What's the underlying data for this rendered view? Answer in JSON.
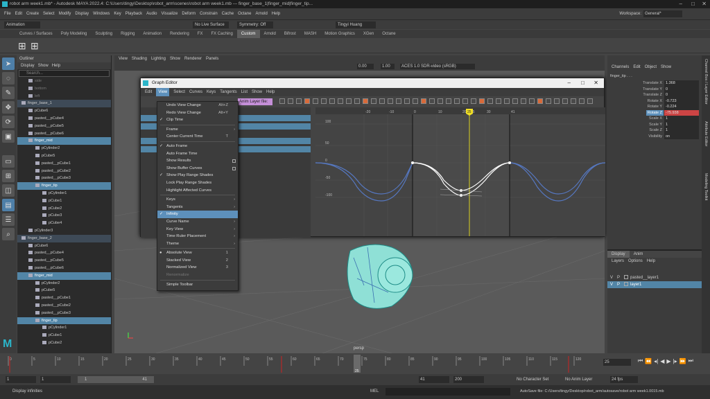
{
  "window_title": "robot arm week1.mb* - Autodesk MAYA 2022.4: C:\\Users\\tingy\\Desktop\\robot_arm\\scenes\\robot arm week1.mb  ---  finger_base_1|finger_mid|finger_tip...",
  "menubar": [
    "File",
    "Edit",
    "Create",
    "Select",
    "Modify",
    "Display",
    "Windows",
    "Key",
    "Playback",
    "Audio",
    "Visualize",
    "Deform",
    "Constrain",
    "Cache",
    "Octane",
    "Arnold",
    "Help"
  ],
  "workspace": {
    "label": "Workspace:",
    "value": "General*"
  },
  "status": {
    "mode": "Animation",
    "live": "No Live Surface",
    "symmetry": "Symmetry: Off",
    "user": "Tingyi Huang"
  },
  "shelf_tabs": [
    "Curves / Surfaces",
    "Poly Modeling",
    "Sculpting",
    "Rigging",
    "Animation",
    "Rendering",
    "FX",
    "FX Caching",
    "Custom",
    "Arnold",
    "Bifrost",
    "MASH",
    "Motion Graphics",
    "XGen",
    "Octane"
  ],
  "shelf_active": "Custom",
  "outliner": {
    "title": "Outliner",
    "menu": [
      "Display",
      "Show",
      "Help"
    ],
    "search_placeholder": "Search...",
    "rows": [
      {
        "t": "side",
        "d": 1,
        "s": "dim"
      },
      {
        "t": "bottom",
        "d": 1,
        "s": "dim"
      },
      {
        "t": "left",
        "d": 1,
        "s": "dim"
      },
      {
        "t": "finger_base_1",
        "d": 0,
        "s": "sel"
      },
      {
        "t": "pCube6",
        "d": 1
      },
      {
        "t": "pasted__pCube4",
        "d": 1
      },
      {
        "t": "pasted__pCube5",
        "d": 1
      },
      {
        "t": "pasted__pCube6",
        "d": 1
      },
      {
        "t": "finger_mid",
        "d": 1,
        "s": "hl"
      },
      {
        "t": "pCylinder2",
        "d": 2
      },
      {
        "t": "pCube5",
        "d": 2
      },
      {
        "t": "pasted__pCube1",
        "d": 2
      },
      {
        "t": "pasted__pCube2",
        "d": 2
      },
      {
        "t": "pasted__pCube3",
        "d": 2
      },
      {
        "t": "finger_tip",
        "d": 2,
        "s": "hl"
      },
      {
        "t": "pCylinder1",
        "d": 3
      },
      {
        "t": "pCube1",
        "d": 3
      },
      {
        "t": "pCube2",
        "d": 3
      },
      {
        "t": "pCube3",
        "d": 3
      },
      {
        "t": "pCube4",
        "d": 3
      },
      {
        "t": "pCylinder3",
        "d": 1
      },
      {
        "t": "finger_base_2",
        "d": 0,
        "s": "sel"
      },
      {
        "t": "pCube6",
        "d": 1
      },
      {
        "t": "pasted__pCube4",
        "d": 1
      },
      {
        "t": "pasted__pCube5",
        "d": 1
      },
      {
        "t": "pasted__pCube6",
        "d": 1
      },
      {
        "t": "finger_mid",
        "d": 1,
        "s": "hl"
      },
      {
        "t": "pCylinder2",
        "d": 2
      },
      {
        "t": "pCube5",
        "d": 2
      },
      {
        "t": "pasted__pCube1",
        "d": 2
      },
      {
        "t": "pasted__pCube2",
        "d": 2
      },
      {
        "t": "pasted__pCube3",
        "d": 2
      },
      {
        "t": "finger_tip",
        "d": 2,
        "s": "hl"
      },
      {
        "t": "pCylinder1",
        "d": 3
      },
      {
        "t": "pCube1",
        "d": 3
      },
      {
        "t": "pCube2",
        "d": 3
      }
    ]
  },
  "viewport": {
    "menu": [
      "View",
      "Shading",
      "Lighting",
      "Show",
      "Renderer",
      "Panels"
    ],
    "exposure": "0.00",
    "gamma": "1.00",
    "colorspace": "ACES 1.0 SDR-video (sRGB)",
    "camera": "persp"
  },
  "graph_editor": {
    "title": "Graph Editor",
    "menu": [
      "Edit",
      "View",
      "Select",
      "Curves",
      "Keys",
      "Tangents",
      "List",
      "Show",
      "Help"
    ],
    "active_menu": "View",
    "anim_layer_label": "Anim Layer file: C:/..",
    "frame_ticks": [
      "-20",
      "-10",
      "0",
      "10",
      "20",
      "25",
      "30",
      "41"
    ],
    "current_frame": "25",
    "value_ticks": [
      "100",
      "50",
      "0",
      "-50",
      "-100"
    ]
  },
  "view_menu": [
    {
      "label": "Undo View Change",
      "sc": "Alt+Z"
    },
    {
      "label": "Redo View Change",
      "sc": "Alt+Y"
    },
    {
      "label": "Clip Time",
      "ck": "✓"
    },
    {
      "sep": true
    },
    {
      "label": "Frame",
      "ar": "›"
    },
    {
      "label": "Center Current Time",
      "sc": "T"
    },
    {
      "sep": true
    },
    {
      "label": "Auto Frame",
      "ck": "✓"
    },
    {
      "label": "Auto Frame Time"
    },
    {
      "label": "Show Results",
      "bx": true
    },
    {
      "label": "Show Buffer Curves",
      "bx": true
    },
    {
      "label": "Show Play Range Shades",
      "ck": "✓"
    },
    {
      "label": "Lock Play Range Shades"
    },
    {
      "label": "Highlight Affected Curves"
    },
    {
      "sep": true
    },
    {
      "label": "Keys",
      "ar": "›"
    },
    {
      "label": "Tangents",
      "ar": "›"
    },
    {
      "label": "Infinity",
      "ck": "✓",
      "hl": true
    },
    {
      "label": "Curve Name",
      "ar": "›"
    },
    {
      "label": "Key View",
      "ar": "›"
    },
    {
      "label": "Time Ruler Placement",
      "ar": "›"
    },
    {
      "label": "Theme",
      "ar": "›"
    },
    {
      "sep": true
    },
    {
      "label": "Absolute View",
      "sc": "1",
      "ck": "●"
    },
    {
      "label": "Stacked View",
      "sc": "2"
    },
    {
      "label": "Normalized View",
      "sc": "3"
    },
    {
      "label": "Renormalize",
      "dis": true
    },
    {
      "sep": true
    },
    {
      "label": "Simple Toolbar"
    }
  ],
  "channel_box": {
    "menu": [
      "Channels",
      "Edit",
      "Object",
      "Show"
    ],
    "object": "finger_tip . . .",
    "channels": [
      {
        "n": "Translate X",
        "v": "1.368"
      },
      {
        "n": "Translate Y",
        "v": "0"
      },
      {
        "n": "Translate Z",
        "v": "0"
      },
      {
        "n": "Rotate X",
        "v": "-0.723"
      },
      {
        "n": "Rotate Y",
        "v": "-0.224"
      },
      {
        "n": "Rotate Z",
        "v": "-75.938",
        "hl": true
      },
      {
        "n": "Scale X",
        "v": "1"
      },
      {
        "n": "Scale Y",
        "v": "1"
      },
      {
        "n": "Scale Z",
        "v": "1"
      },
      {
        "n": "Visibility",
        "v": "on"
      }
    ]
  },
  "side_tabs": [
    "Channel Box / Layer Editor",
    "Attribute Editor",
    "Modeling Toolkit"
  ],
  "layers": {
    "tabs": [
      "Display",
      "Anim"
    ],
    "menu": [
      "Layers",
      "Options",
      "Help"
    ],
    "rows": [
      {
        "name": "pasted__layer1"
      },
      {
        "name": "layer1",
        "hl": true
      }
    ]
  },
  "timeline": {
    "ticks": [
      "0",
      "5",
      "10",
      "15",
      "20",
      "25",
      "30",
      "35",
      "40",
      "45",
      "50",
      "55",
      "60",
      "65",
      "70",
      "75",
      "80",
      "85",
      "90",
      "95",
      "100",
      "105",
      "110",
      "115",
      "120"
    ],
    "current": "25",
    "current_field": "25"
  },
  "range": {
    "start": "1",
    "start2": "1",
    "range_label": "1",
    "range_end": "41",
    "end": "41",
    "end2": "200",
    "character": "No Character Set",
    "anim_layer": "No Anim Layer",
    "fps": "24 fps"
  },
  "helpline": {
    "text": "Display infinities",
    "lang": "MEL",
    "autosave": "AutoSave file: C:/Users/tingy/Desktop/robot_arm/autosave/robot arm week1.0015.mb"
  }
}
